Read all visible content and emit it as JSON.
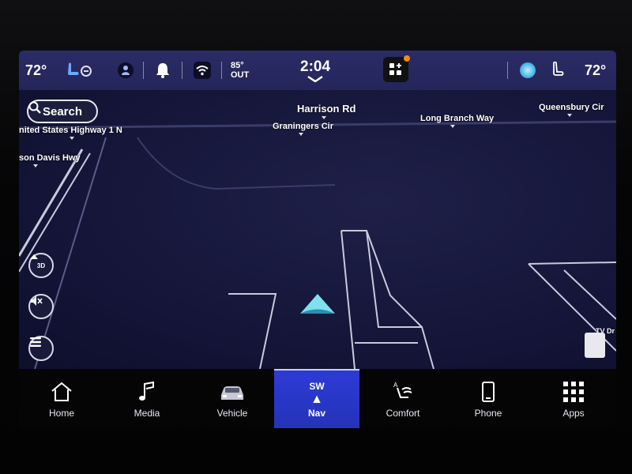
{
  "status": {
    "driver_temp": "72°",
    "passenger_temp": "72°",
    "outside_temp": "85°",
    "outside_label": "OUT",
    "time": "2:04"
  },
  "map": {
    "search_label": "Search",
    "roads": {
      "harrison": "Harrison Rd",
      "graningers": "Graningers Cir",
      "long_branch": "Long Branch Way",
      "queensbury": "Queensbury Cir",
      "us_highway": "nited States Highway 1 N",
      "davis": "son Davis Hwy",
      "tv": "TV Dr"
    },
    "view_mode_label": "3D"
  },
  "nav": {
    "home": "Home",
    "media": "Media",
    "vehicle": "Vehicle",
    "nav": "Nav",
    "nav_heading": "SW",
    "comfort": "Comfort",
    "phone": "Phone",
    "apps": "Apps"
  },
  "colors": {
    "accent": "#2a37c8",
    "status_bar": "#2b2c66",
    "map_bg": "#15163a",
    "notification": "#f28a1a"
  }
}
